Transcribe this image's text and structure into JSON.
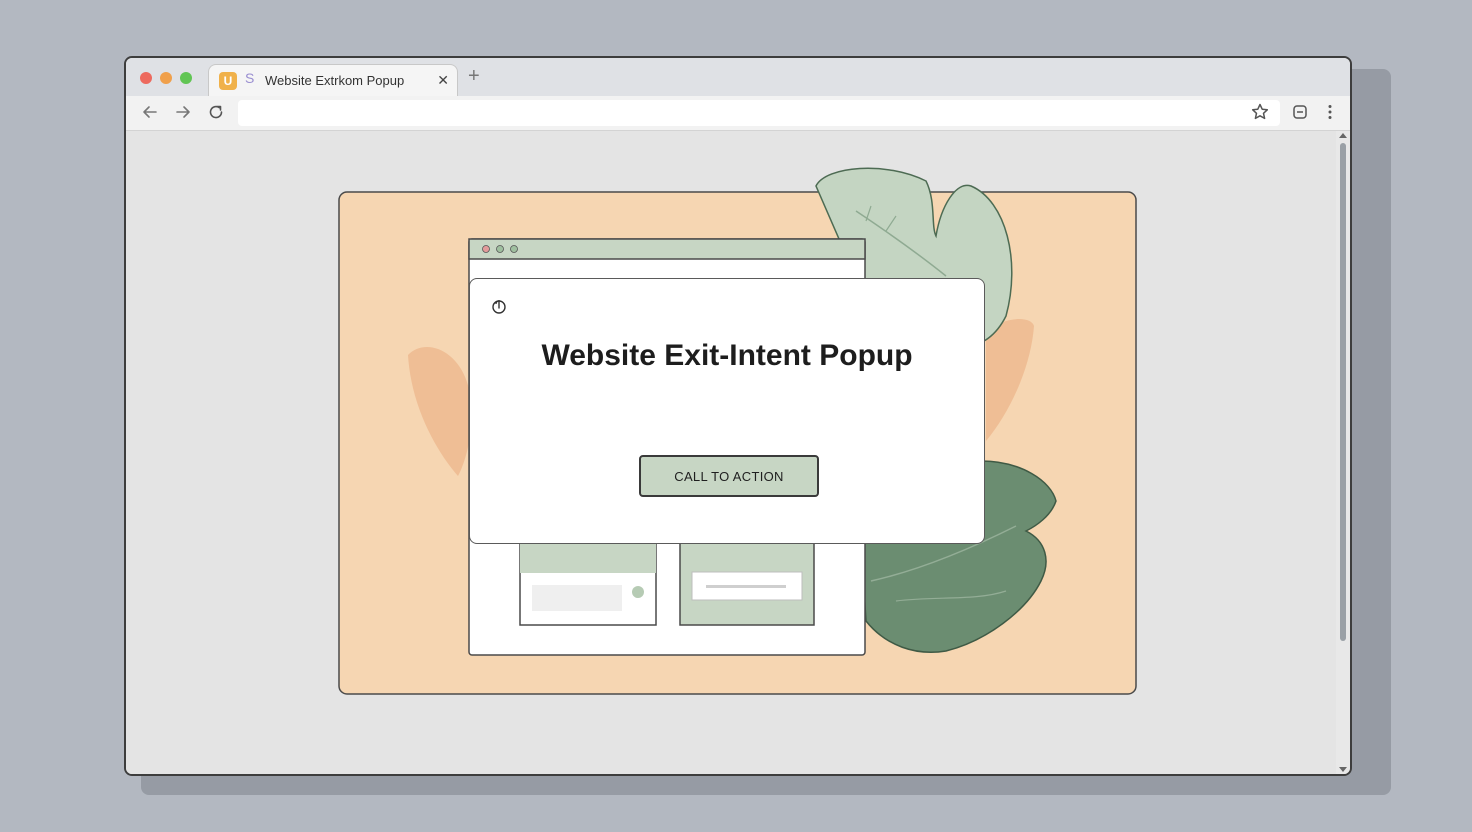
{
  "browser": {
    "tab_title": "Website Extrkom Popup",
    "tab_close_icon": "close-icon",
    "new_tab_label": "+",
    "favicon_label": "U",
    "secondary_favicon": "S",
    "address": ""
  },
  "popup": {
    "title": "Website Exit-Intent Popup",
    "cta_label": "CALL TO ACTION",
    "icon": "pointer-hand-icon"
  },
  "colors": {
    "backdrop": "#b3b8c1",
    "peach_panel": "#f6d6b2",
    "sage": "#c7d6c4",
    "dark_leaf": "#6b8d71",
    "light_leaf": "#c4d5c2"
  }
}
